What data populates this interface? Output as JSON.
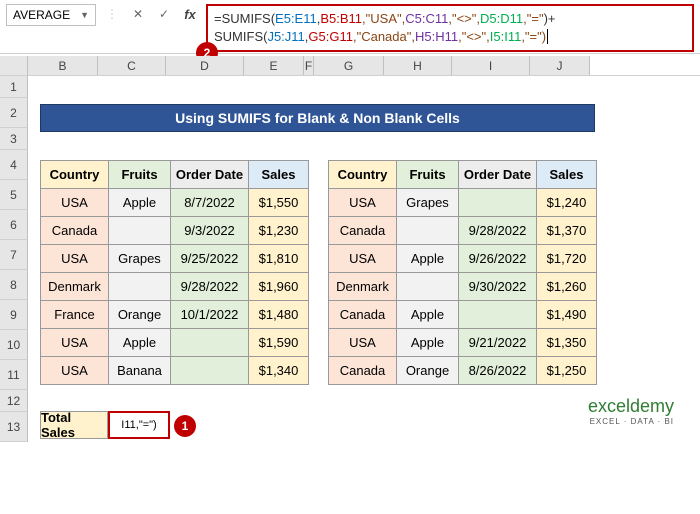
{
  "toolbar": {
    "namebox": "AVERAGE",
    "functions_label": "functions",
    "cancel_label": "✕",
    "enter_label": "✓",
    "fx_label": "fx"
  },
  "formula": {
    "prefix": "=SUMIFS(",
    "r1a": "E5:E11",
    "c1": ",",
    "r1b": "B5:B11",
    "t1": ",\"USA\",",
    "r1c": "C5:C11",
    "t2": ",\"<>\",",
    "r1d": "D5:D11",
    "t3": ",\"=\"",
    "close_plus": ")+",
    "line2_prefix": "SUMIFS(",
    "r2a": "J5:J11",
    "r2b": "G5:G11",
    "t4": ",\"Canada\",",
    "r2c": "H5:H11",
    "t5": ",\"<>\",",
    "r2d": "I5:I11",
    "t6": ",\"=\")",
    "badge": "2"
  },
  "columns": [
    "B",
    "C",
    "D",
    "E",
    "F",
    "G",
    "H",
    "I",
    "J"
  ],
  "row_nums": [
    "1",
    "2",
    "3",
    "4",
    "5",
    "6",
    "7",
    "8",
    "9",
    "10",
    "11",
    "12",
    "13"
  ],
  "title": "Using SUMIFS for Blank & Non Blank Cells",
  "headers": {
    "country": "Country",
    "fruits": "Fruits",
    "date": "Order Date",
    "sales": "Sales"
  },
  "table1": [
    {
      "country": "USA",
      "fruits": "Apple",
      "date": "8/7/2022",
      "sales": "$1,550"
    },
    {
      "country": "Canada",
      "fruits": "",
      "date": "9/3/2022",
      "sales": "$1,230"
    },
    {
      "country": "USA",
      "fruits": "Grapes",
      "date": "9/25/2022",
      "sales": "$1,810"
    },
    {
      "country": "Denmark",
      "fruits": "",
      "date": "9/28/2022",
      "sales": "$1,960"
    },
    {
      "country": "France",
      "fruits": "Orange",
      "date": "10/1/2022",
      "sales": "$1,480"
    },
    {
      "country": "USA",
      "fruits": "Apple",
      "date": "",
      "sales": "$1,590"
    },
    {
      "country": "USA",
      "fruits": "Banana",
      "date": "",
      "sales": "$1,340"
    }
  ],
  "table2": [
    {
      "country": "USA",
      "fruits": "Grapes",
      "date": "",
      "sales": "$1,240"
    },
    {
      "country": "Canada",
      "fruits": "",
      "date": "9/28/2022",
      "sales": "$1,370"
    },
    {
      "country": "USA",
      "fruits": "Apple",
      "date": "9/26/2022",
      "sales": "$1,720"
    },
    {
      "country": "Denmark",
      "fruits": "",
      "date": "9/30/2022",
      "sales": "$1,260"
    },
    {
      "country": "Canada",
      "fruits": "Apple",
      "date": "",
      "sales": "$1,490"
    },
    {
      "country": "USA",
      "fruits": "Apple",
      "date": "9/21/2022",
      "sales": "$1,350"
    },
    {
      "country": "Canada",
      "fruits": "Orange",
      "date": "8/26/2022",
      "sales": "$1,250"
    }
  ],
  "total": {
    "label": "Total Sales",
    "value": "I11,\"=\")",
    "badge": "1"
  },
  "logo": {
    "brand": "exceldemy",
    "tag": "EXCEL · DATA · BI"
  }
}
